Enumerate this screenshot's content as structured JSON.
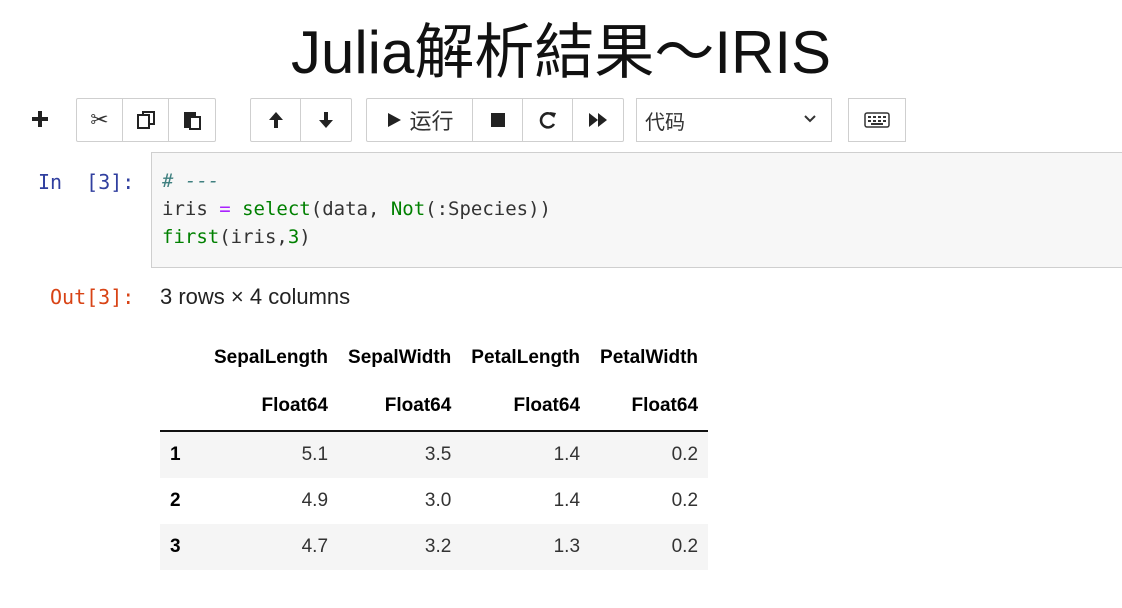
{
  "slide": {
    "title": "Julia解析結果～IRIS"
  },
  "toolbar": {
    "buttons": [
      {
        "name": "insert-cell",
        "icon": "plus-icon",
        "glyph": "+"
      },
      {
        "name": "cut",
        "icon": "scissors-icon",
        "glyph": "✂"
      },
      {
        "name": "copy",
        "icon": "copy-icon",
        "glyph": "⎘"
      },
      {
        "name": "paste",
        "icon": "paste-icon",
        "glyph": "📋"
      },
      {
        "name": "move-up",
        "icon": "arrow-up-icon",
        "glyph": "↑"
      },
      {
        "name": "move-down",
        "icon": "arrow-down-icon",
        "glyph": "↓"
      },
      {
        "name": "run",
        "icon": "play-icon",
        "glyph": "▶"
      },
      {
        "name": "interrupt",
        "icon": "stop-icon",
        "glyph": "■"
      },
      {
        "name": "restart",
        "icon": "refresh-icon",
        "glyph": "C"
      },
      {
        "name": "restart-run-all",
        "icon": "fast-forward-icon",
        "glyph": "⏩"
      },
      {
        "name": "command-palette",
        "icon": "keyboard-icon",
        "glyph": "⌨"
      }
    ],
    "run_label": "运行",
    "cell_type": {
      "selected": "代码"
    }
  },
  "cell_in": {
    "prompt": "In  [3]:",
    "code_lines": [
      "# ---",
      "iris = select(data, Not(:Species))",
      "first(iris,3)"
    ]
  },
  "cell_out": {
    "prompt": "Out[3]:",
    "summary": "3 rows × 4 columns",
    "table": {
      "columns": [
        "SepalLength",
        "SepalWidth",
        "PetalLength",
        "PetalWidth"
      ],
      "types": [
        "Float64",
        "Float64",
        "Float64",
        "Float64"
      ],
      "rows": [
        {
          "index": "1",
          "values": [
            "5.1",
            "3.5",
            "1.4",
            "0.2"
          ]
        },
        {
          "index": "2",
          "values": [
            "4.9",
            "3.0",
            "1.4",
            "0.2"
          ]
        },
        {
          "index": "3",
          "values": [
            "4.7",
            "3.2",
            "1.3",
            "0.2"
          ]
        }
      ]
    }
  },
  "colors": {
    "in_prompt": "#303f9f",
    "out_prompt": "#d84315",
    "comment": "#408080",
    "operator": "#aa22ff",
    "function": "#008000"
  }
}
